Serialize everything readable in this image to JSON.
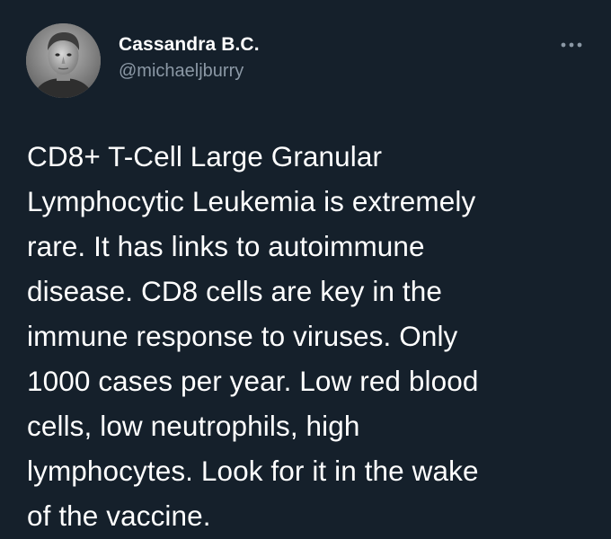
{
  "tweet": {
    "author": {
      "display_name": "Cassandra B.C.",
      "handle": "@michaeljburry",
      "avatar": "profile-photo"
    },
    "more_icon": "more-horizontal-icon",
    "text": "CD8+ T-Cell Large Granular\nLymphocytic Leukemia is extremely\nrare. It has links to autoimmune\ndisease. CD8 cells are key in the\nimmune response to viruses. Only\n1000 cases per year. Low red blood\ncells, low neutrophils, high\nlymphocytes. Look for it in the wake\nof the vaccine."
  },
  "colors": {
    "background": "#15202b",
    "primary_text": "#ffffff",
    "secondary_text": "#8b98a5"
  }
}
